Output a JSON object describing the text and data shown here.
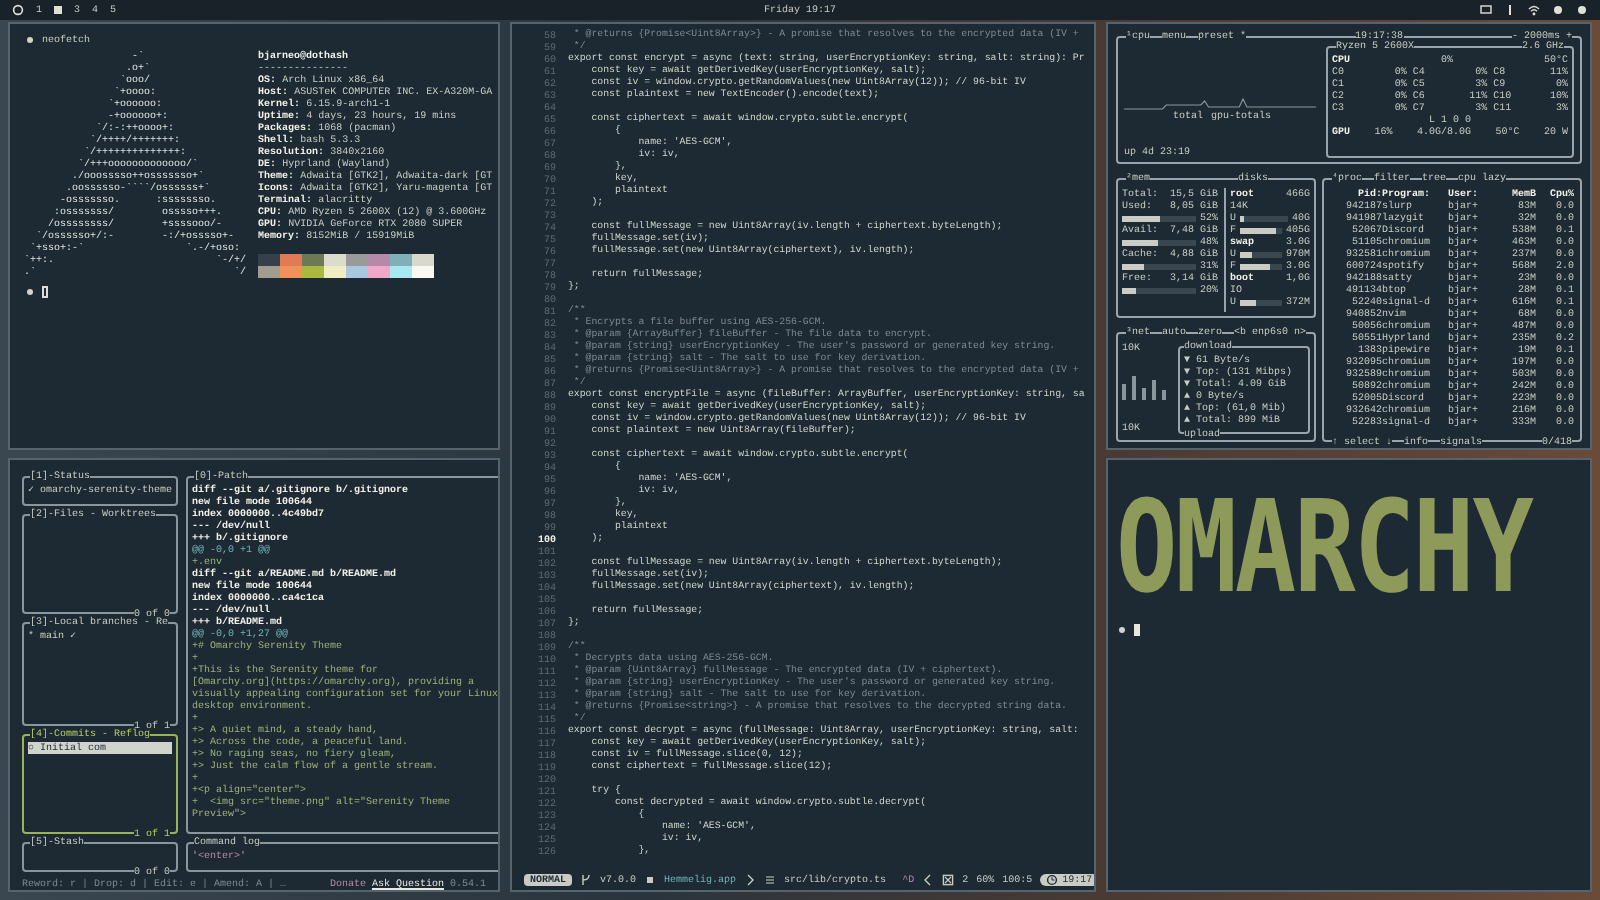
{
  "top_bar": {
    "workspaces": [
      {
        "label": "1",
        "selected": false
      },
      {
        "selected": true
      },
      {
        "label": "3",
        "selected": false
      },
      {
        "label": "4",
        "selected": false
      },
      {
        "label": "5",
        "selected": false
      }
    ],
    "clock": "Friday 19:17"
  },
  "neofetch": {
    "command": "neofetch",
    "logo": [
      "                  -`",
      "                 .o+`",
      "                `ooo/",
      "               `+oooo:",
      "              `+oooooo:",
      "              -+oooooo+:",
      "            `/:-:++oooo+:",
      "           `/++++/+++++++:",
      "          `/++++++++++++++:",
      "         `/+++ooooooooooooo/`",
      "        ./ooosssso++osssssso+`",
      "       .oossssso-````/ossssss+`",
      "      -osssssso.      :ssssssso.",
      "     :osssssss/        osssso+++.",
      "    /ossssssss/        +ssssooo/-",
      "  `/ossssso+/:-        -:/+osssso+-",
      " `+sso+:-`                 `.-/+oso:",
      "`++:.                           `-/+/",
      ".`                                 `/"
    ],
    "user": "bjarneo@dothash",
    "separator": "---------------",
    "info": [
      {
        "key": "OS:",
        "value": "Arch Linux x86_64"
      },
      {
        "key": "Host:",
        "value": "ASUSTeK COMPUTER INC. EX-A320M-GA"
      },
      {
        "key": "Kernel:",
        "value": "6.15.9-arch1-1"
      },
      {
        "key": "Uptime:",
        "value": "4 days, 23 hours, 19 mins"
      },
      {
        "key": "Packages:",
        "value": "1068 (pacman)"
      },
      {
        "key": "Shell:",
        "value": "bash 5.3.3"
      },
      {
        "key": "Resolution:",
        "value": "3840x2160"
      },
      {
        "key": "DE:",
        "value": "Hyprland (Wayland)"
      },
      {
        "key": "Theme:",
        "value": "Adwaita [GTK2], Adwaita-dark [GT"
      },
      {
        "key": "Icons:",
        "value": "Adwaita [GTK2], Yaru-magenta [GT"
      },
      {
        "key": "Terminal:",
        "value": "alacritty"
      },
      {
        "key": "CPU:",
        "value": "AMD Ryzen 5 2600X (12) @ 3.600GHz"
      },
      {
        "key": "GPU:",
        "value": "NVIDIA GeForce RTX 2080 SUPER"
      },
      {
        "key": "Memory:",
        "value": "8152MiB / 15919MiB"
      }
    ],
    "palette": [
      {
        "color": "#34404a"
      },
      {
        "color": "#e07b53"
      },
      {
        "color": "#6b7a55"
      },
      {
        "color": "#dcdccc"
      },
      {
        "color": "#9a9a9a"
      },
      {
        "color": "#b58aa8"
      },
      {
        "color": "#7fb0b8"
      },
      {
        "color": "#d8d8cc"
      },
      {
        "color": "#a09c90"
      },
      {
        "color": "#f0905a"
      },
      {
        "color": "#a8b840"
      },
      {
        "color": "#f0eec0"
      },
      {
        "color": "#a8c8e0"
      },
      {
        "color": "#f0a8c8"
      },
      {
        "color": "#a8e8f0"
      },
      {
        "color": "#f8f8f0"
      }
    ]
  },
  "lazygit": {
    "panels": [
      {
        "title": "[1]-Status",
        "focused": false,
        "items": [
          {
            "text": "✓ omarchy-serenity-theme",
            "selected": false
          }
        ]
      },
      {
        "title": "[2]-Files - Worktrees",
        "focused": false,
        "footer": "0 of 0"
      },
      {
        "title": "[3]-Local branches - Re",
        "focused": false,
        "footer": "1 of 1",
        "items": [
          {
            "text": "* main ✓",
            "selected": false
          }
        ]
      },
      {
        "title": "[4]-Commits - Reflog",
        "focused": true,
        "footer": "1 of 1",
        "items": [
          {
            "text": "○ Initial com",
            "selected": true
          }
        ]
      },
      {
        "title": "[5]-Stash",
        "focused": false,
        "footer": "0 of 0"
      }
    ],
    "patch": {
      "title": "[0]-Patch",
      "lines": [
        {
          "kind": "header",
          "text": "diff --git a/.gitignore b/.gitignore"
        },
        {
          "kind": "header",
          "text": "new file mode 100644"
        },
        {
          "kind": "header",
          "text": "index 0000000..4c49bd7"
        },
        {
          "kind": "header",
          "text": "--- /dev/null"
        },
        {
          "kind": "header",
          "text": "+++ b/.gitignore"
        },
        {
          "kind": "hunk",
          "text": "@@ -0,0 +1 @@"
        },
        {
          "kind": "added",
          "text": "+.env"
        },
        {
          "kind": "header",
          "text": "diff --git a/README.md b/README.md"
        },
        {
          "kind": "header",
          "text": "new file mode 100644"
        },
        {
          "kind": "header",
          "text": "index 0000000..ca4c1ca"
        },
        {
          "kind": "header",
          "text": "--- /dev/null"
        },
        {
          "kind": "header",
          "text": "+++ b/README.md"
        },
        {
          "kind": "hunk",
          "text": "@@ -0,0 +1,27 @@"
        },
        {
          "kind": "added",
          "text": "+# Omarchy Serenity Theme"
        },
        {
          "kind": "added",
          "text": "+"
        },
        {
          "kind": "added",
          "text": "+This is the Serenity theme for"
        },
        {
          "kind": "added",
          "text": "[Omarchy.org](https://omarchy.org), providing a"
        },
        {
          "kind": "added",
          "text": "visually appealing configuration set for your Linux"
        },
        {
          "kind": "added",
          "text": "desktop environment."
        },
        {
          "kind": "added",
          "text": "+"
        },
        {
          "kind": "added",
          "text": "+> A quiet mind, a steady hand,"
        },
        {
          "kind": "added",
          "text": "+> Across the code, a peaceful land."
        },
        {
          "kind": "added",
          "text": "+> No raging seas, no fiery gleam,"
        },
        {
          "kind": "added",
          "text": "+> Just the calm flow of a gentle stream."
        },
        {
          "kind": "added",
          "text": "+"
        },
        {
          "kind": "added",
          "text": "+<p align=\"center\">"
        },
        {
          "kind": "added",
          "text": "+  <img src=\"theme.png\" alt=\"Serenity Theme"
        },
        {
          "kind": "added",
          "text": "Preview\">"
        }
      ]
    },
    "command_log": {
      "title": "Command log",
      "lines": [
        "'<enter>'"
      ]
    },
    "status_bar": {
      "keys": "Reword: r | Drop: d | Edit: e | Amend: A | …",
      "donate": "Donate",
      "ask": "Ask Question",
      "version": "0.54.1"
    }
  },
  "editor": {
    "lines": [
      {
        "n": "58",
        "kind": "comment",
        "current": false,
        "text": " * @returns {Promise<Uint8Array>} - A promise that resolves to the encrypted data (IV +"
      },
      {
        "n": "59",
        "kind": "comment",
        "current": false,
        "text": " */"
      },
      {
        "n": "60",
        "kind": "code",
        "current": false,
        "text": "export const encrypt = async (text: string, userEncryptionKey: string, salt: string): Pr"
      },
      {
        "n": "61",
        "kind": "code",
        "current": false,
        "text": "    const key = await getDerivedKey(userEncryptionKey, salt);"
      },
      {
        "n": "62",
        "kind": "code",
        "current": false,
        "text": "    const iv = window.crypto.getRandomValues(new Uint8Array(12)); // 96-bit IV"
      },
      {
        "n": "63",
        "kind": "code",
        "current": false,
        "text": "    const plaintext = new TextEncoder().encode(text);"
      },
      {
        "n": "64",
        "current": false
      },
      {
        "n": "65",
        "kind": "code",
        "current": false,
        "text": "    const ciphertext = await window.crypto.subtle.encrypt("
      },
      {
        "n": "66",
        "kind": "code",
        "current": false,
        "text": "        {"
      },
      {
        "n": "67",
        "kind": "code",
        "current": false,
        "text": "            name: 'AES-GCM',"
      },
      {
        "n": "68",
        "kind": "code",
        "current": false,
        "text": "            iv: iv,"
      },
      {
        "n": "69",
        "kind": "code",
        "current": false,
        "text": "        },"
      },
      {
        "n": "70",
        "kind": "code",
        "current": false,
        "text": "        key,"
      },
      {
        "n": "71",
        "kind": "code",
        "current": false,
        "text": "        plaintext"
      },
      {
        "n": "72",
        "kind": "code",
        "current": false,
        "text": "    );"
      },
      {
        "n": "73",
        "current": false
      },
      {
        "n": "74",
        "kind": "code",
        "current": false,
        "text": "    const fullMessage = new Uint8Array(iv.length + ciphertext.byteLength);"
      },
      {
        "n": "75",
        "kind": "code",
        "current": false,
        "text": "    fullMessage.set(iv);"
      },
      {
        "n": "76",
        "kind": "code",
        "current": false,
        "text": "    fullMessage.set(new Uint8Array(ciphertext), iv.length);"
      },
      {
        "n": "77",
        "current": false
      },
      {
        "n": "78",
        "kind": "code",
        "current": false,
        "text": "    return fullMessage;"
      },
      {
        "n": "79",
        "kind": "code",
        "current": false,
        "text": "};"
      },
      {
        "n": "80",
        "current": false
      },
      {
        "n": "81",
        "kind": "comment",
        "current": false,
        "text": "/**"
      },
      {
        "n": "82",
        "kind": "comment",
        "current": false,
        "text": " * Encrypts a file buffer using AES-256-GCM."
      },
      {
        "n": "83",
        "kind": "comment",
        "current": false,
        "text": " * @param {ArrayBuffer} fileBuffer - The file data to encrypt."
      },
      {
        "n": "84",
        "kind": "comment",
        "current": false,
        "text": " * @param {string} userEncryptionKey - The user's password or generated key string."
      },
      {
        "n": "85",
        "kind": "comment",
        "current": false,
        "text": " * @param {string} salt - The salt to use for key derivation."
      },
      {
        "n": "86",
        "kind": "comment",
        "current": false,
        "text": " * @returns {Promise<Uint8Array>} - A promise that resolves to the encrypted data (IV +"
      },
      {
        "n": "87",
        "kind": "comment",
        "current": false,
        "text": " */"
      },
      {
        "n": "88",
        "kind": "code",
        "current": false,
        "text": "export const encryptFile = async (fileBuffer: ArrayBuffer, userEncryptionKey: string, sa"
      },
      {
        "n": "89",
        "kind": "code",
        "current": false,
        "text": "    const key = await getDerivedKey(userEncryptionKey, salt);"
      },
      {
        "n": "90",
        "kind": "code",
        "current": false,
        "text": "    const iv = window.crypto.getRandomValues(new Uint8Array(12)); // 96-bit IV"
      },
      {
        "n": "91",
        "kind": "code",
        "current": false,
        "text": "    const plaintext = new Uint8Array(fileBuffer);"
      },
      {
        "n": "92",
        "current": false
      },
      {
        "n": "93",
        "kind": "code",
        "current": false,
        "text": "    const ciphertext = await window.crypto.subtle.encrypt("
      },
      {
        "n": "94",
        "kind": "code",
        "current": false,
        "text": "        {"
      },
      {
        "n": "95",
        "kind": "code",
        "current": false,
        "text": "            name: 'AES-GCM',"
      },
      {
        "n": "96",
        "kind": "code",
        "current": false,
        "text": "            iv: iv,"
      },
      {
        "n": "97",
        "kind": "code",
        "current": false,
        "text": "        },"
      },
      {
        "n": "98",
        "kind": "code",
        "current": false,
        "text": "        key,"
      },
      {
        "n": "99",
        "kind": "code",
        "current": false,
        "text": "        plaintext"
      },
      {
        "n": "100",
        "kind": "code",
        "current": true,
        "text": "    );"
      },
      {
        "n": "101",
        "current": false
      },
      {
        "n": "102",
        "kind": "code",
        "current": false,
        "text": "    const fullMessage = new Uint8Array(iv.length + ciphertext.byteLength);"
      },
      {
        "n": "103",
        "kind": "code",
        "current": false,
        "text": "    fullMessage.set(iv);"
      },
      {
        "n": "104",
        "kind": "code",
        "current": false,
        "text": "    fullMessage.set(new Uint8Array(ciphertext), iv.length);"
      },
      {
        "n": "105",
        "current": false
      },
      {
        "n": "106",
        "kind": "code",
        "current": false,
        "text": "    return fullMessage;"
      },
      {
        "n": "107",
        "kind": "code",
        "current": false,
        "text": "};"
      },
      {
        "n": "108",
        "current": false
      },
      {
        "n": "109",
        "kind": "comment",
        "current": false,
        "text": "/**"
      },
      {
        "n": "110",
        "kind": "comment",
        "current": false,
        "text": " * Decrypts data using AES-256-GCM."
      },
      {
        "n": "111",
        "kind": "comment",
        "current": false,
        "text": " * @param {Uint8Array} fullMessage - The encrypted data (IV + ciphertext)."
      },
      {
        "n": "112",
        "kind": "comment",
        "current": false,
        "text": " * @param {string} userEncryptionKey - The user's password or generated key string."
      },
      {
        "n": "113",
        "kind": "comment",
        "current": false,
        "text": " * @param {string} salt - The salt to use for key derivation."
      },
      {
        "n": "114",
        "kind": "comment",
        "current": false,
        "text": " * @returns {Promise<string>} - A promise that resolves to the decrypted string data."
      },
      {
        "n": "115",
        "kind": "comment",
        "current": false,
        "text": " */"
      },
      {
        "n": "116",
        "kind": "code",
        "current": false,
        "text": "export const decrypt = async (fullMessage: Uint8Array, userEncryptionKey: string, salt:"
      },
      {
        "n": "117",
        "kind": "code",
        "current": false,
        "text": "    const key = await getDerivedKey(userEncryptionKey, salt);"
      },
      {
        "n": "118",
        "kind": "code",
        "current": false,
        "text": "    const iv = fullMessage.slice(0, 12);"
      },
      {
        "n": "119",
        "kind": "code",
        "current": false,
        "text": "    const ciphertext = fullMessage.slice(12);"
      },
      {
        "n": "120",
        "current": false
      },
      {
        "n": "121",
        "kind": "code",
        "current": false,
        "text": "    try {"
      },
      {
        "n": "122",
        "kind": "code",
        "current": false,
        "text": "        const decrypted = await window.crypto.subtle.decrypt("
      },
      {
        "n": "123",
        "kind": "code",
        "current": false,
        "text": "            {"
      },
      {
        "n": "124",
        "kind": "code",
        "current": false,
        "text": "                name: 'AES-GCM',"
      },
      {
        "n": "125",
        "kind": "code",
        "current": false,
        "text": "                iv: iv,"
      },
      {
        "n": "126",
        "kind": "code",
        "current": false,
        "text": "            },"
      }
    ],
    "status": {
      "mode": "NORMAL",
      "version": "v7.0.0",
      "project": "Hemmelig.app",
      "file": "src/lib/crypto.ts",
      "keys": "^D",
      "diagnostics": "2",
      "percent": "60%",
      "position": "100:5",
      "time": "19:17"
    }
  },
  "btop": {
    "cpu": {
      "title": [
        "¹cpu",
        "menu",
        "preset *"
      ],
      "time": "19:17:38",
      "interval": "- 2000ms +",
      "graph_labels": [
        "total",
        "gpu-totals"
      ],
      "uptime": "up 4d 23:19",
      "model": "Ryzen 5 2600X",
      "freq": "2.6 GHz",
      "total": {
        "label": "CPU",
        "value": "0%",
        "temp": "50°C"
      },
      "cores": [
        {
          "name": "C0",
          "value": "0%"
        },
        {
          "name": "C1",
          "value": "0%"
        },
        {
          "name": "C2",
          "value": "0%"
        },
        {
          "name": "C3",
          "value": "0%"
        },
        {
          "name": "C4",
          "value": "0%"
        },
        {
          "name": "C5",
          "value": "3%"
        },
        {
          "name": "C6",
          "value": "11%"
        },
        {
          "name": "C7",
          "value": "3%"
        },
        {
          "name": "C8",
          "value": "11%"
        },
        {
          "name": "C9",
          "value": "0%"
        },
        {
          "name": "C10",
          "value": "10%"
        },
        {
          "name": "C11",
          "value": "3%"
        }
      ],
      "load": "L 1 0 0",
      "gpu": {
        "label": "GPU",
        "value": "16%",
        "mem": "4.0G/8.0G",
        "temp": "50°C",
        "power": "20 W"
      }
    },
    "mem": {
      "title": "²mem",
      "rows": [
        {
          "label": "Total:",
          "value": "15,5 GiB"
        },
        {
          "label": "Used:",
          "value": "8,05 GiB",
          "percent": "52%",
          "level": 0.52
        },
        {
          "label": "Avail:",
          "value": "7,48 GiB",
          "percent": "48%",
          "level": 0.48
        },
        {
          "label": "Cache:",
          "value": "4,88 GiB",
          "percent": "31%",
          "level": 0.31
        },
        {
          "label": "Free:",
          "value": "3,14 GiB",
          "percent": "20%",
          "level": 0.2
        }
      ]
    },
    "disks": {
      "title": "disks",
      "rows": [
        {
          "kind": "head",
          "label": "root",
          "value": "466G"
        },
        {
          "kind": "text",
          "label": "14K"
        },
        {
          "kind": "bar",
          "label": "U",
          "value": "40G",
          "level": 0.1
        },
        {
          "kind": "bar",
          "label": "F",
          "value": "405G",
          "level": 0.85
        },
        {
          "kind": "head",
          "label": "swap",
          "value": "3.0G"
        },
        {
          "kind": "bar",
          "label": "U",
          "value": "970M",
          "level": 0.3
        },
        {
          "kind": "bar",
          "label": "F",
          "value": "3.0G",
          "level": 0.7
        },
        {
          "kind": "head",
          "label": "boot",
          "value": "1,0G"
        },
        {
          "kind": "text",
          "label": "IO"
        },
        {
          "kind": "bar",
          "label": "U",
          "value": "372M",
          "level": 0.36
        }
      ]
    },
    "net": {
      "title": [
        "³net",
        "auto",
        "zero",
        "<b enp6s0 n>"
      ],
      "scale_top": "10K",
      "scale_bottom": "10K",
      "box_title": "download",
      "box_footer": "upload",
      "lines": [
        "▼ 61 Byte/s",
        "▼ Top: (131 Mibps)",
        "▼ Total: 4.09 GiB",
        "▲ 0 Byte/s",
        "▲ Top: (61,0 Mib)",
        "▲ Total: 899 MiB"
      ]
    },
    "proc": {
      "title": [
        "⁴proc",
        "filter",
        "tree",
        "cpu lazy"
      ],
      "columns": [
        "Pid:",
        "Program:",
        "User:",
        "MemB",
        "Cpu%"
      ],
      "rows": [
        [
          "942187",
          "slurp",
          "bjar+",
          "83M",
          "0.0"
        ],
        [
          "941987",
          "lazygit",
          "bjar+",
          "32M",
          "0.0"
        ],
        [
          "52067",
          "Discord",
          "bjar+",
          "538M",
          "0.1"
        ],
        [
          "51105",
          "chromium",
          "bjar+",
          "463M",
          "0.0"
        ],
        [
          "932581",
          "chromium",
          "bjar+",
          "237M",
          "0.0"
        ],
        [
          "600724",
          "spotify",
          "bjar+",
          "568M",
          "2.0"
        ],
        [
          "942188",
          "satty",
          "bjar+",
          "23M",
          "0.0"
        ],
        [
          "491134",
          "btop",
          "bjar+",
          "28M",
          "0.1"
        ],
        [
          "52240",
          "signal-d",
          "bjar+",
          "616M",
          "0.1"
        ],
        [
          "940852",
          "nvim",
          "bjar+",
          "68M",
          "0.0"
        ],
        [
          "50056",
          "chromium",
          "bjar+",
          "487M",
          "0.0"
        ],
        [
          "50551",
          "Hyprland",
          "bjar+",
          "235M",
          "0.2"
        ],
        [
          "1383",
          "pipewire",
          "bjar+",
          "19M",
          "0.1"
        ],
        [
          "932095",
          "chromium",
          "bjar+",
          "197M",
          "0.0"
        ],
        [
          "932589",
          "chromium",
          "bjar+",
          "503M",
          "0.0"
        ],
        [
          "50892",
          "chromium",
          "bjar+",
          "242M",
          "0.0"
        ],
        [
          "52005",
          "Discord",
          "bjar+",
          "223M",
          "0.0"
        ],
        [
          "932642",
          "chromium",
          "bjar+",
          "216M",
          "0.0"
        ],
        [
          "52283",
          "signal-d",
          "bjar+",
          "333M",
          "0.0"
        ]
      ],
      "footer": [
        "↑ select ↓",
        "info",
        "signals"
      ],
      "count": "0/418"
    }
  },
  "terminal": {
    "logo": "OMARCHY"
  }
}
